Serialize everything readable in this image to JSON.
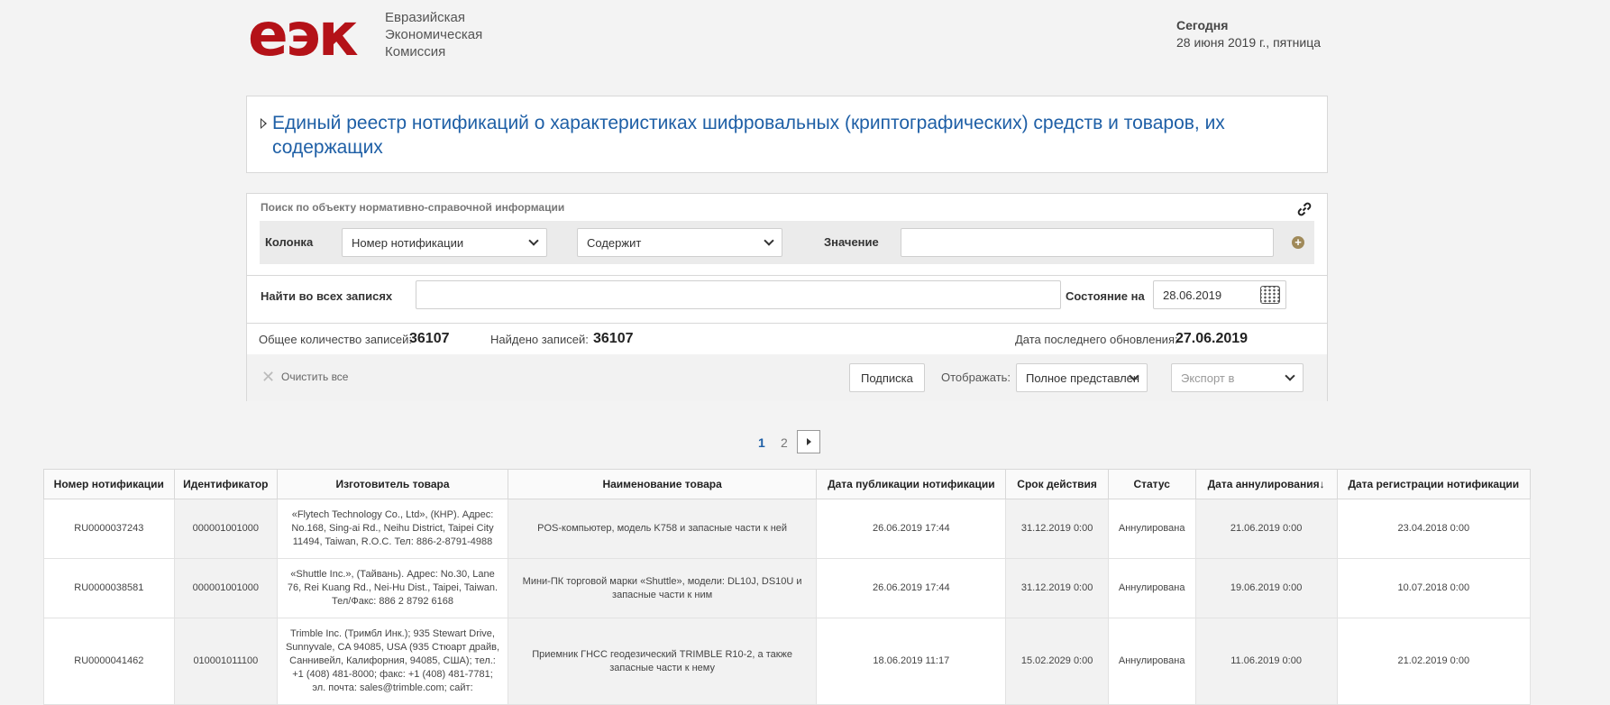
{
  "header": {
    "logo_mark": "еэк",
    "logo_lines": [
      "Евразийская",
      "Экономическая",
      "Комиссия"
    ],
    "today_label": "Сегодня",
    "today_date": "28 июня 2019 г., пятница"
  },
  "title": "Единый реестр нотификаций о характеристиках шифровальных (криптографических) средств и товаров, их содержащих",
  "search": {
    "caption": "Поиск по объекту нормативно-справочной информации",
    "column_label": "Колонка",
    "column_value": "Номер нотификации",
    "operator_value": "Содержит",
    "value_label": "Значение",
    "value_input": "",
    "find_all_label": "Найти во всех записях",
    "find_all_value": "",
    "state_label": "Состояние на",
    "state_date": "28.06.2019"
  },
  "stats": {
    "total_label": "Общее количество записей:",
    "total_value": "36107",
    "found_label": "Найдено записей:",
    "found_value": "36107",
    "updated_label": "Дата последнего обновления:",
    "updated_value": "27.06.2019"
  },
  "actions": {
    "clear_label": "Очистить все",
    "subscribe_label": "Подписка",
    "display_label": "Отображать:",
    "display_value": "Полное представлен",
    "export_value": "Экспорт в"
  },
  "pager": {
    "current": "1",
    "next": "2"
  },
  "colors": {
    "brand": "#b41218",
    "link": "#1e5fa6"
  },
  "table": {
    "headers": [
      "Номер нотификации",
      "Идентификатор",
      "Изготовитель товара",
      "Наименование товара",
      "Дата публикации нотификации",
      "Срок действия",
      "Статус",
      "Дата аннулирования",
      "Дата регистрации нотификации"
    ],
    "sort_indicator": "↓",
    "rows": [
      [
        "RU0000037243",
        "000001001000",
        "«Flytech Technology Co., Ltd», (КНР). Адрес: No.168, Sing-ai Rd., Neihu District, Taipei City 11494, Taiwan, R.O.C. Тел: 886-2-8791-4988",
        "POS-компьютер, модель K758 и запасные части к ней",
        "26.06.2019 17:44",
        "31.12.2019 0:00",
        "Аннулирована",
        "21.06.2019 0:00",
        "23.04.2018 0:00"
      ],
      [
        "RU0000038581",
        "000001001000",
        "«Shuttle Inc.», (Тайвань). Адрес: No.30, Lane 76, Rei Kuang Rd., Nei-Hu Dist., Taipei, Taiwan. Тел/Факс: 886 2 8792 6168",
        "Мини-ПК торговой марки «Shuttle», модели: DL10J, DS10U и запасные части к ним",
        "26.06.2019 17:44",
        "31.12.2019 0:00",
        "Аннулирована",
        "19.06.2019 0:00",
        "10.07.2018 0:00"
      ],
      [
        "RU0000041462",
        "010001011100",
        "Trimble Inc. (Тримбл Инк.); 935 Stewart Drive, Sunnyvale, CA 94085, USA (935 Стюарт драйв, Саннивейл, Калифорния, 94085, США); тел.: +1 (408) 481-8000; факс: +1 (408) 481-7781; эл. почта: sales@trimble.com; сайт:",
        "Приемник ГНСС геодезический TRIMBLE R10-2, а также запасные части к нему",
        "18.06.2019 11:17",
        "15.02.2029 0:00",
        "Аннулирована",
        "11.06.2019 0:00",
        "21.02.2019 0:00"
      ]
    ]
  }
}
